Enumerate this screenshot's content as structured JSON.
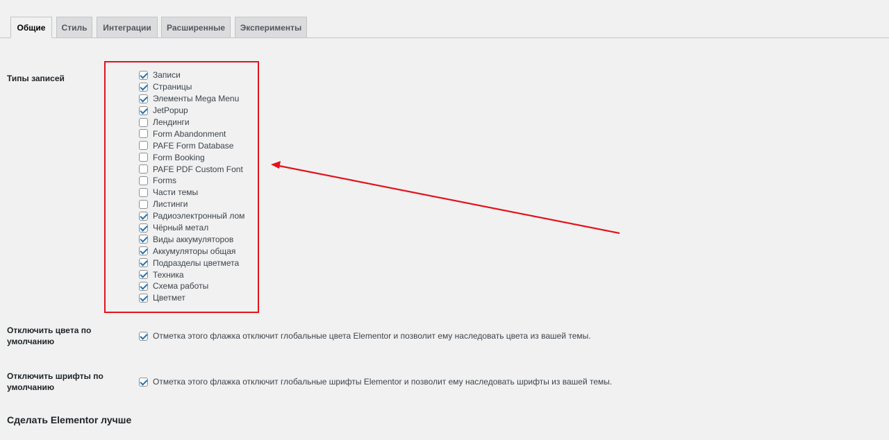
{
  "tabs": [
    {
      "label": "Общие",
      "active": true
    },
    {
      "label": "Стиль",
      "active": false
    },
    {
      "label": "Интеграции",
      "active": false
    },
    {
      "label": "Расширенные",
      "active": false
    },
    {
      "label": "Эксперименты",
      "active": false
    }
  ],
  "post_types": {
    "label": "Типы записей",
    "items": [
      {
        "label": "Записи",
        "checked": true
      },
      {
        "label": "Страницы",
        "checked": true
      },
      {
        "label": "Элементы Mega Menu",
        "checked": true
      },
      {
        "label": "JetPopup",
        "checked": true
      },
      {
        "label": "Лендинги",
        "checked": false
      },
      {
        "label": "Form Abandonment",
        "checked": false
      },
      {
        "label": "PAFE Form Database",
        "checked": false
      },
      {
        "label": "Form Booking",
        "checked": false
      },
      {
        "label": "PAFE PDF Custom Font",
        "checked": false
      },
      {
        "label": "Forms",
        "checked": false
      },
      {
        "label": "Части темы",
        "checked": false
      },
      {
        "label": "Листинги",
        "checked": false
      },
      {
        "label": "Радиоэлектронный лом",
        "checked": true
      },
      {
        "label": "Чёрный метал",
        "checked": true
      },
      {
        "label": "Виды аккумуляторов",
        "checked": true
      },
      {
        "label": "Аккумуляторы общая",
        "checked": true
      },
      {
        "label": "Подразделы цветмета",
        "checked": true
      },
      {
        "label": "Техника",
        "checked": true
      },
      {
        "label": "Схема работы",
        "checked": true
      },
      {
        "label": "Цветмет",
        "checked": true
      }
    ]
  },
  "disable_colors": {
    "label_line1": "Отключить цвета по",
    "label_line2": "умолчанию",
    "checked": true,
    "description": "Отметка этого флажка отключит глобальные цвета Elementor и позволит ему наследовать цвета из вашей темы."
  },
  "disable_fonts": {
    "label_line1": "Отключить шрифты по",
    "label_line2": "умолчанию",
    "checked": true,
    "description": "Отметка этого флажка отключит глобальные шрифты Elementor и позволит ему наследовать шрифты из вашей темы."
  },
  "improve_section": {
    "title": "Сделать Elementor лучше"
  },
  "colors": {
    "annotation_red": "#e3121b",
    "checkbox_blue": "#2271b1",
    "page_bg": "#f1f1f1"
  }
}
